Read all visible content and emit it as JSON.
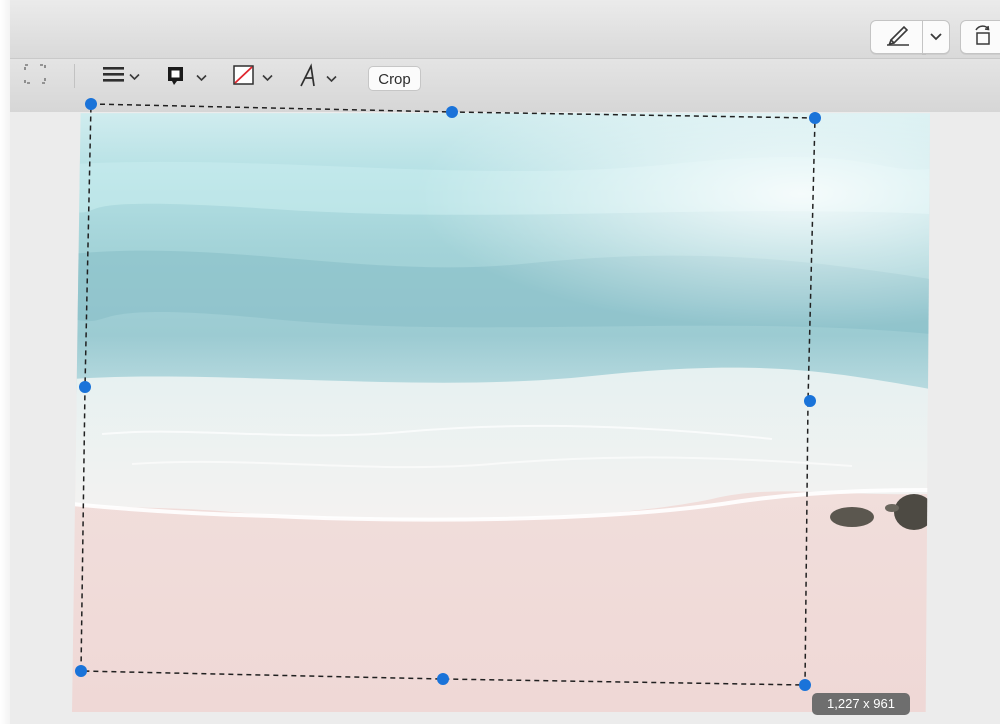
{
  "toolbar": {
    "crop_label": "Crop",
    "tools": [
      {
        "icon": "selection-tool-icon"
      },
      {
        "icon": "shape-style-icon"
      },
      {
        "icon": "border-color-icon"
      },
      {
        "icon": "fill-color-icon"
      },
      {
        "icon": "text-style-icon"
      }
    ]
  },
  "titlebar": {
    "buttons": [
      {
        "icon": "markup-pen-icon"
      },
      {
        "icon": "chevron-down-icon"
      },
      {
        "icon": "rotate-icon"
      }
    ]
  },
  "selection": {
    "size_label": "1,227 x 961"
  },
  "colors": {
    "handle": "#1a73d9",
    "sea_light": "#bfe6e8",
    "sea_deep": "#7fbfc8",
    "foam": "#f2f4f3",
    "sand": "#f1dcd9"
  }
}
